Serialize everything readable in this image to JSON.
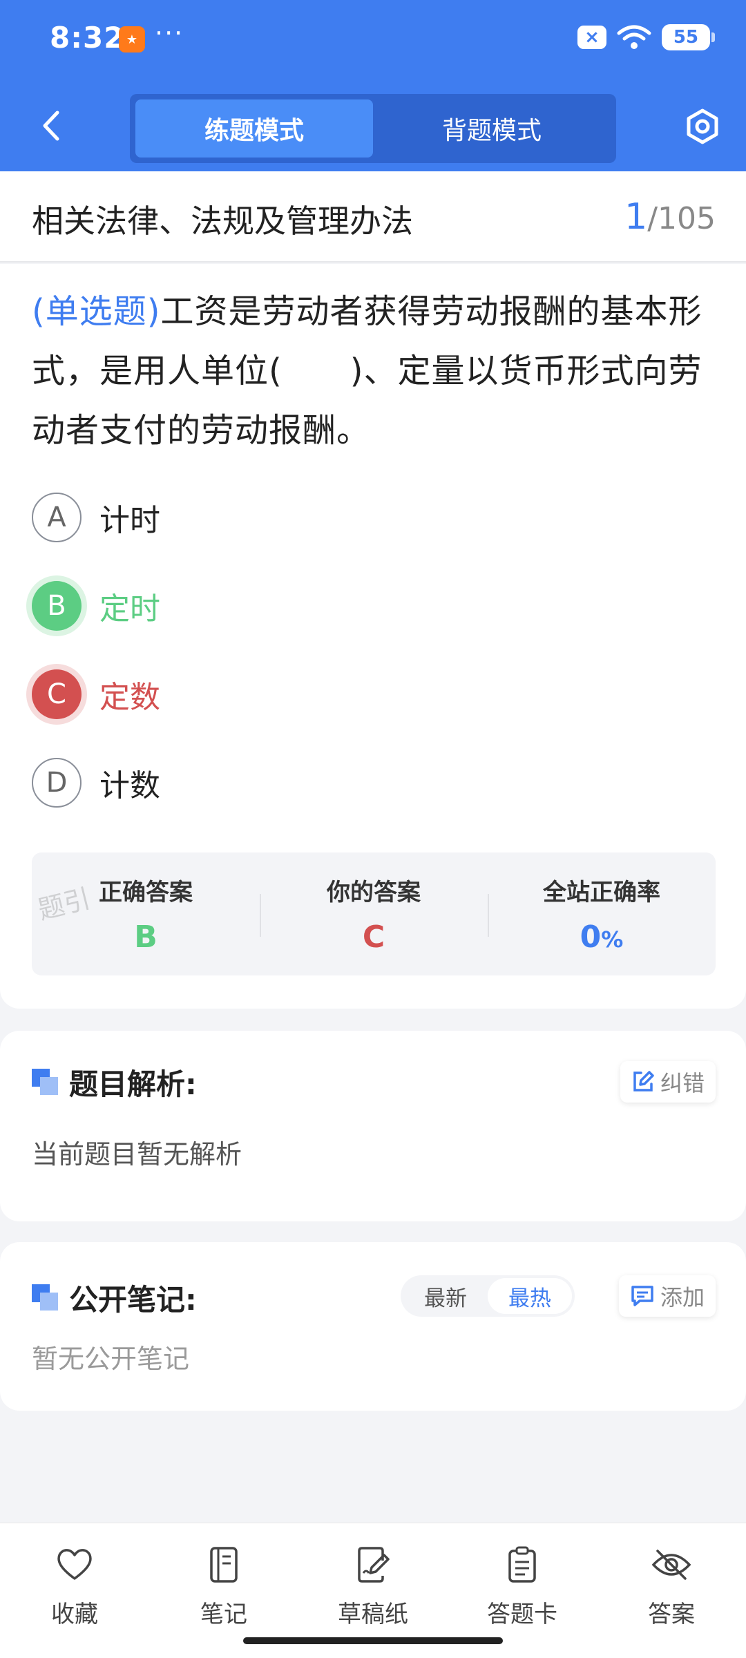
{
  "status_bar": {
    "time": "8:32",
    "dots": "···",
    "battery": "55"
  },
  "nav": {
    "tabs": [
      {
        "label": "练题模式",
        "active": true
      },
      {
        "label": "背题模式",
        "active": false
      }
    ]
  },
  "title_row": {
    "title": "相关法律、法规及管理办法",
    "current": "1",
    "total": "/105"
  },
  "question": {
    "type_label": "(单选题)",
    "text": "工资是劳动者获得劳动报酬的基本形式，是用人单位(　　)、定量以货币形式向劳动者支付的劳动报酬。",
    "options": [
      {
        "letter": "A",
        "text": "计时",
        "state": "normal"
      },
      {
        "letter": "B",
        "text": "定时",
        "state": "correct"
      },
      {
        "letter": "C",
        "text": "定数",
        "state": "wrong"
      },
      {
        "letter": "D",
        "text": "计数",
        "state": "normal"
      }
    ]
  },
  "answers": {
    "correct_label": "正确答案",
    "correct_value": "B",
    "yours_label": "你的答案",
    "yours_value": "C",
    "rate_label": "全站正确率",
    "rate_value": "0",
    "rate_unit": "%",
    "watermark": "题引"
  },
  "analysis": {
    "title": "题目解析:",
    "body": "当前题目暂无解析",
    "report_label": "纠错"
  },
  "notes": {
    "title": "公开笔记:",
    "body": "暂无公开笔记",
    "sort_options": [
      {
        "label": "最新",
        "active": false
      },
      {
        "label": "最热",
        "active": true
      }
    ],
    "add_label": "添加"
  },
  "bottom_bar": {
    "items": [
      {
        "label": "收藏",
        "icon": "heart-icon"
      },
      {
        "label": "笔记",
        "icon": "notebook-icon"
      },
      {
        "label": "草稿纸",
        "icon": "draft-paper-icon"
      },
      {
        "label": "答题卡",
        "icon": "answer-card-icon"
      },
      {
        "label": "答案",
        "icon": "eye-off-icon"
      }
    ]
  },
  "colors": {
    "primary": "#3f7df0",
    "correct": "#5ccd83",
    "wrong": "#d35050"
  }
}
